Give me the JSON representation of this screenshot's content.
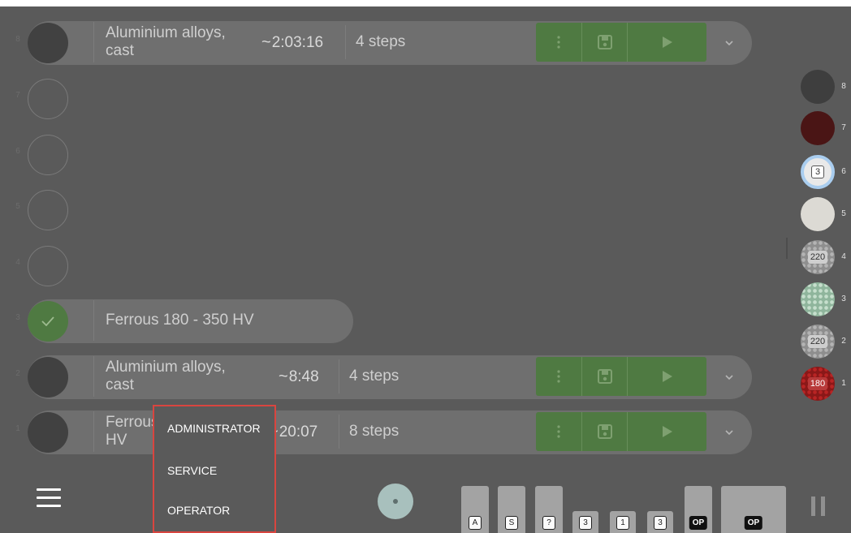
{
  "rows": [
    {
      "slot": "8",
      "state": "filled",
      "name": "Aluminium alloys, cast",
      "time": "2:03:16",
      "steps": "4 steps"
    },
    {
      "slot": "7",
      "state": "empty"
    },
    {
      "slot": "6",
      "state": "empty"
    },
    {
      "slot": "5",
      "state": "empty"
    },
    {
      "slot": "4",
      "state": "empty"
    },
    {
      "slot": "3",
      "state": "done",
      "name": "Ferrous 180 - 350 HV"
    },
    {
      "slot": "2",
      "state": "filled",
      "name": "Aluminium alloys, cast",
      "time": "8:48",
      "steps": "4 steps"
    },
    {
      "slot": "1",
      "state": "filled",
      "name_partial": "Ferrous",
      "name_line2": "HV",
      "time": "20:07",
      "steps": "8 steps"
    }
  ],
  "time_prefix": "~",
  "rail": [
    {
      "num": "8",
      "label": ""
    },
    {
      "num": "7",
      "label": ""
    },
    {
      "num": "6",
      "label": "3"
    },
    {
      "num": "5",
      "label": ""
    },
    {
      "num": "4",
      "label": "220"
    },
    {
      "num": "3",
      "label": ""
    },
    {
      "num": "2",
      "label": "220"
    },
    {
      "num": "1",
      "label": "180"
    }
  ],
  "bottom": {
    "chips": [
      "A",
      "S",
      "?",
      "3",
      "1",
      "3",
      "OP",
      "OP"
    ]
  },
  "menu": {
    "items": [
      "ADMINISTRATOR",
      "SERVICE",
      "OPERATOR"
    ]
  },
  "colors": {
    "background": "#5a5a5a",
    "row_pill": "#6f6f6f",
    "action_green": "#4f7a42",
    "menu_border": "#d9453f"
  }
}
